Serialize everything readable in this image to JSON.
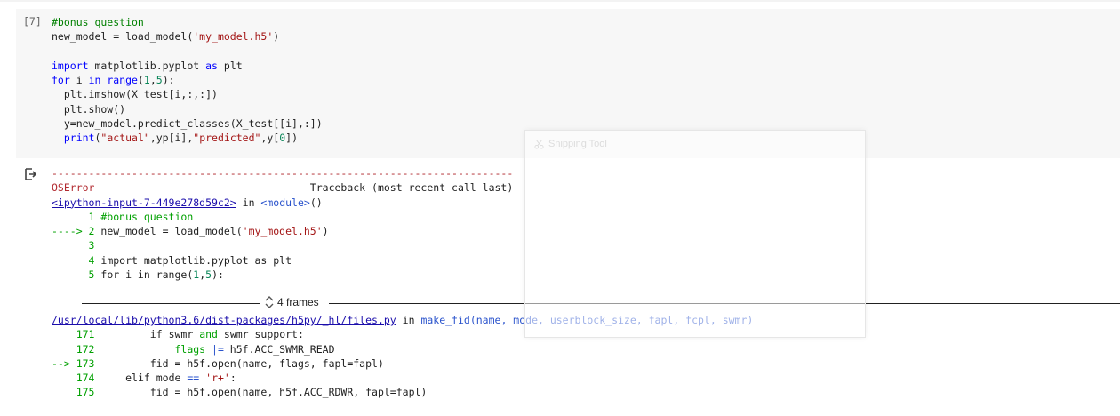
{
  "cell": {
    "execution_count": "[7]",
    "code_lines": [
      [
        {
          "t": "#bonus question",
          "c": "cm"
        }
      ],
      [
        {
          "t": "new_model = load_model(",
          "c": ""
        },
        {
          "t": "'my_model.h5'",
          "c": "st"
        },
        {
          "t": ")",
          "c": ""
        }
      ],
      [
        {
          "t": "",
          "c": ""
        }
      ],
      [
        {
          "t": "import",
          "c": "kw"
        },
        {
          "t": " matplotlib.pyplot ",
          "c": ""
        },
        {
          "t": "as",
          "c": "kw"
        },
        {
          "t": " plt",
          "c": ""
        }
      ],
      [
        {
          "t": "for",
          "c": "kw"
        },
        {
          "t": " i ",
          "c": ""
        },
        {
          "t": "in",
          "c": "kw"
        },
        {
          "t": " ",
          "c": ""
        },
        {
          "t": "range",
          "c": "kw"
        },
        {
          "t": "(",
          "c": ""
        },
        {
          "t": "1",
          "c": "nm"
        },
        {
          "t": ",",
          "c": ""
        },
        {
          "t": "5",
          "c": "nm"
        },
        {
          "t": "):",
          "c": ""
        }
      ],
      [
        {
          "t": "  plt.imshow(X_test[i,:,:])",
          "c": ""
        }
      ],
      [
        {
          "t": "  plt.show()",
          "c": ""
        }
      ],
      [
        {
          "t": "  y=new_model.predict_classes(X_test[[i],:])",
          "c": ""
        }
      ],
      [
        {
          "t": "  ",
          "c": ""
        },
        {
          "t": "print",
          "c": "kw"
        },
        {
          "t": "(",
          "c": ""
        },
        {
          "t": "\"actual\"",
          "c": "st"
        },
        {
          "t": ",yp[i],",
          "c": ""
        },
        {
          "t": "\"predicted\"",
          "c": "st"
        },
        {
          "t": ",y[",
          "c": ""
        },
        {
          "t": "0",
          "c": "nm"
        },
        {
          "t": "])",
          "c": ""
        }
      ]
    ]
  },
  "output": {
    "icon": "output-arrow-icon",
    "lines": [
      [
        {
          "t": "---------------------------------------------------------------------------",
          "c": "red"
        }
      ],
      [
        {
          "t": "OSError",
          "c": "red"
        },
        {
          "t": "                                   Traceback (most recent call last)",
          "c": ""
        }
      ],
      [
        {
          "t": "<ipython-input-7-449e278d59c2>",
          "c": "link"
        },
        {
          "t": " in ",
          "c": ""
        },
        {
          "t": "<module>",
          "c": "blu"
        },
        {
          "t": "()",
          "c": ""
        }
      ],
      [
        {
          "t": "      1 #bonus question",
          "c": "grn"
        }
      ],
      [
        {
          "t": "----> 2 ",
          "c": "grn"
        },
        {
          "t": "new_model = load_model(",
          "c": ""
        },
        {
          "t": "'my_model.h5'",
          "c": "st"
        },
        {
          "t": ")",
          "c": ""
        }
      ],
      [
        {
          "t": "      3",
          "c": "grn"
        }
      ],
      [
        {
          "t": "      4 ",
          "c": "grn"
        },
        {
          "t": "import matplotlib.pyplot as plt",
          "c": ""
        }
      ],
      [
        {
          "t": "      5 ",
          "c": "grn"
        },
        {
          "t": "for i in range(",
          "c": ""
        },
        {
          "t": "1",
          "c": "nm"
        },
        {
          "t": ",",
          "c": ""
        },
        {
          "t": "5",
          "c": "nm"
        },
        {
          "t": "):",
          "c": ""
        }
      ]
    ],
    "frames_label": "4 frames",
    "lines2": [
      [
        {
          "t": "/usr/local/lib/python3.6/dist-packages/h5py/_hl/files.py",
          "c": "link"
        },
        {
          "t": " in ",
          "c": ""
        },
        {
          "t": "make_fid",
          "c": "blu"
        },
        {
          "t": "(name, mode, userblock_size, fapl, fcpl, swmr)",
          "c": "blu"
        }
      ],
      [
        {
          "t": "    171         ",
          "c": "grn"
        },
        {
          "t": "if",
          "c": ""
        },
        {
          "t": " swmr ",
          "c": ""
        },
        {
          "t": "and",
          "c": "grn"
        },
        {
          "t": " swmr_support:",
          "c": ""
        }
      ],
      [
        {
          "t": "    172             flags ",
          "c": "grn"
        },
        {
          "t": "|=",
          "c": "blu"
        },
        {
          "t": " h5f.ACC_SWMR_READ",
          "c": ""
        }
      ],
      [
        {
          "t": "--> 173 ",
          "c": "grn"
        },
        {
          "t": "        fid = h5f.open(name, flags, fapl=fapl)",
          "c": ""
        }
      ],
      [
        {
          "t": "    174     ",
          "c": "grn"
        },
        {
          "t": "elif",
          "c": ""
        },
        {
          "t": " mode ",
          "c": ""
        },
        {
          "t": "==",
          "c": "blu"
        },
        {
          "t": " ",
          "c": ""
        },
        {
          "t": "'r+'",
          "c": "st"
        },
        {
          "t": ":",
          "c": ""
        }
      ],
      [
        {
          "t": "    175         ",
          "c": "grn"
        },
        {
          "t": "fid = h5f.open(name, h5f.ACC_RDWR, fapl=fapl)",
          "c": ""
        }
      ]
    ]
  },
  "snipping_tool": {
    "title": "Snipping Tool",
    "icon": "scissors-icon"
  }
}
